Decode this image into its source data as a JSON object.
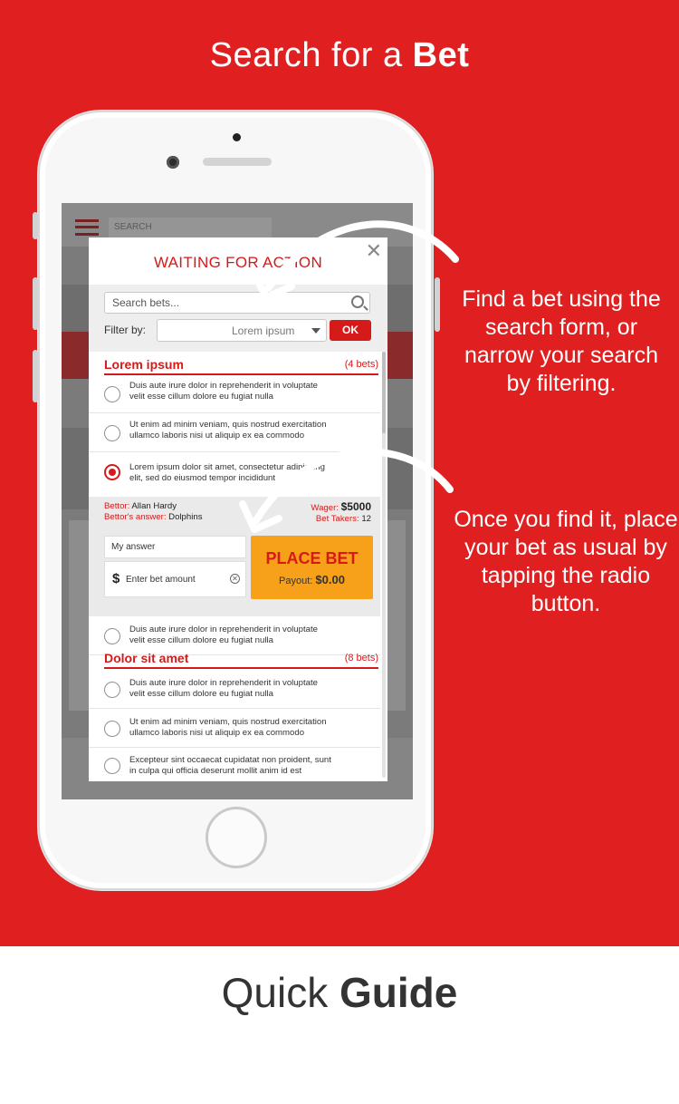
{
  "header": {
    "title_regular": "Search for a ",
    "title_bold": "Bet"
  },
  "callouts": {
    "first": "Find a bet using the search form, or narrow your search by filtering.",
    "second": "Once you find it, place your bet as usual by tapping the radio button."
  },
  "footer": {
    "title_regular": "Quick ",
    "title_bold": "Guide"
  },
  "background_app": {
    "search_placeholder": "SEARCH"
  },
  "modal": {
    "title": "WAITING FOR ACTION",
    "search_placeholder": "Search bets...",
    "filter_label": "Filter by:",
    "filter_value": "Lorem ipsum",
    "ok_label": "OK",
    "groups": [
      {
        "name": "Lorem ipsum",
        "count": "(4 bets)",
        "items": [
          {
            "text": "Duis aute irure dolor in reprehenderit in voluptate\nvelit esse cillum dolore eu fugiat nulla",
            "selected": false
          },
          {
            "text": "Ut enim ad minim veniam, quis nostrud exercitation\nullamco laboris nisi ut aliquip ex ea commodo",
            "selected": false
          },
          {
            "text": "Lorem ipsum dolor sit amet, consectetur adipiscing\nelit, sed do eiusmod tempor incididunt",
            "selected": true
          },
          {
            "text": "Duis aute irure dolor in reprehenderit in voluptate\nvelit esse cillum dolore eu fugiat nulla",
            "selected": false
          }
        ]
      },
      {
        "name": "Dolor sit amet",
        "count": "(8 bets)",
        "items": [
          {
            "text": "Duis aute irure dolor in reprehenderit in voluptate\nvelit esse cillum dolore eu fugiat nulla",
            "selected": false
          },
          {
            "text": "Ut enim ad minim veniam, quis nostrud exercitation\nullamco laboris nisi ut aliquip ex ea commodo",
            "selected": false
          },
          {
            "text": "Excepteur sint occaecat cupidatat non proident, sunt\nin culpa qui officia deserunt mollit anim id est",
            "selected": false
          }
        ]
      }
    ],
    "bet_detail": {
      "bettor_label": "Bettor:",
      "bettor_name": "Allan Hardy",
      "answer_label": "Bettor's answer:",
      "answer_value": "Dolphins",
      "wager_label": "Wager:",
      "wager_value": "$5000",
      "takers_label": "Bet Takers:",
      "takers_value": "12",
      "my_answer_placeholder": "My answer",
      "amount_symbol": "$",
      "amount_placeholder": "Enter bet amount",
      "place_bet_label": "PLACE BET",
      "payout_label": "Payout:",
      "payout_value": "$0.00"
    }
  },
  "colors": {
    "brand_red": "#e02020",
    "accent_red": "#d61a1a",
    "place_bet_orange": "#f7a11a"
  }
}
